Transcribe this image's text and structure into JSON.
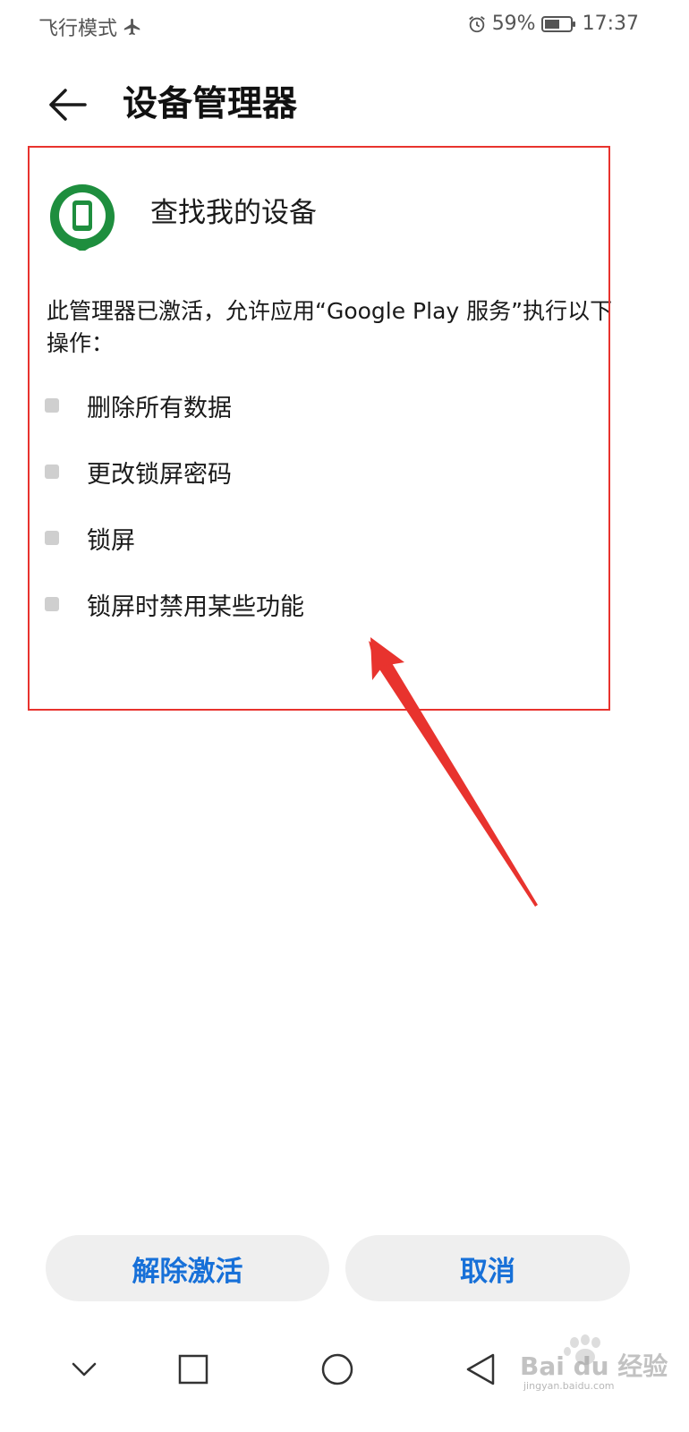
{
  "status_bar": {
    "mode_text": "飞行模式",
    "mode_icon": "airplane-icon",
    "alarm_icon": "alarm-icon",
    "battery_percent": "59%",
    "battery_level": 0.59,
    "time": "17:37"
  },
  "header": {
    "back_icon": "back-arrow-icon",
    "title": "设备管理器"
  },
  "app": {
    "icon": "find-my-device-icon",
    "name": "查找我的设备",
    "icon_color": "#1e8e3e"
  },
  "description": "此管理器已激活，允许应用“Google Play 服务”执行以下操作：",
  "permissions": [
    {
      "label": "删除所有数据"
    },
    {
      "label": "更改锁屏密码"
    },
    {
      "label": "锁屏"
    },
    {
      "label": "锁屏时禁用某些功能"
    }
  ],
  "buttons": {
    "deactivate": "解除激活",
    "cancel": "取消"
  },
  "nav_bar": {
    "down_icon": "chevron-down-icon",
    "recents_icon": "square-recents-icon",
    "home_icon": "circle-home-icon",
    "back_icon": "triangle-back-icon"
  },
  "watermark": {
    "text": "Bai du 经验",
    "sub": "jingyan.baidu.com"
  },
  "colors": {
    "accent": "#1770d8",
    "annotation": "#e8332e",
    "button_bg": "#efefef"
  }
}
